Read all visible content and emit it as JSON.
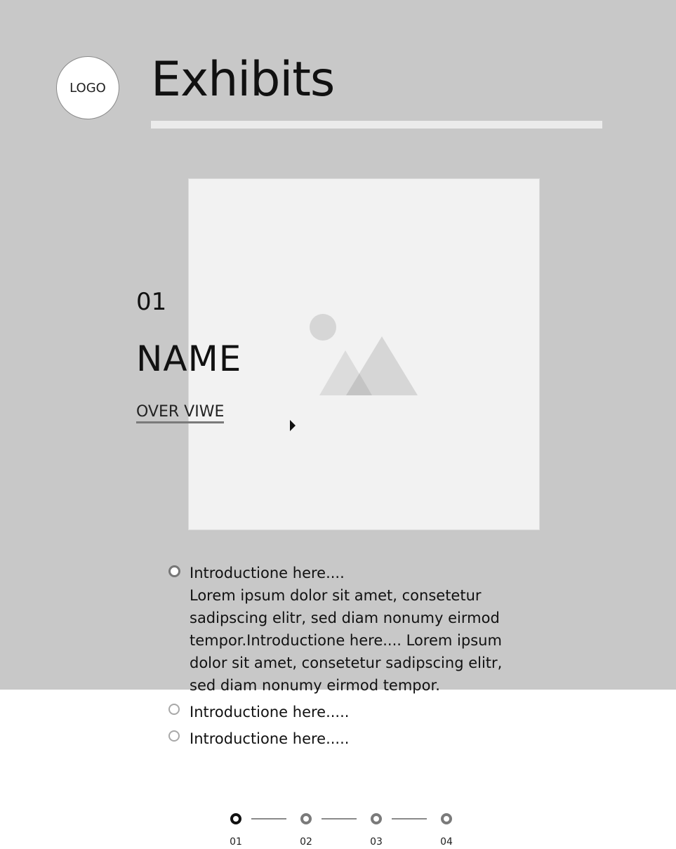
{
  "header": {
    "logo_text": "LOGO",
    "title": "Exhibits"
  },
  "exhibit": {
    "number": "01",
    "name": "NAME",
    "overview_link": "OVER VIWE",
    "image_icon": "image-placeholder-icon"
  },
  "intro": {
    "items": [
      {
        "title": "Introductione here....",
        "body": "Lorem ipsum dolor sit amet, consetetur sadipscing elitr, sed diam nonumy eirmod tempor.Introductione here.... Lorem ipsum dolor sit amet, consetetur sadipscing elitr, sed diam nonumy eirmod tempor.",
        "expanded": true
      },
      {
        "title": "Introductione here.....",
        "expanded": false
      },
      {
        "title": "Introductione here.....",
        "expanded": false
      }
    ]
  },
  "pager": {
    "pages": [
      "01",
      "02",
      "03",
      "04"
    ],
    "active_page": "01"
  },
  "colors": {
    "band_background": "#c8c8c8",
    "image_background": "#f2f2f2",
    "active_dot": "#111111",
    "inactive_dot": "#7a7a7a"
  }
}
